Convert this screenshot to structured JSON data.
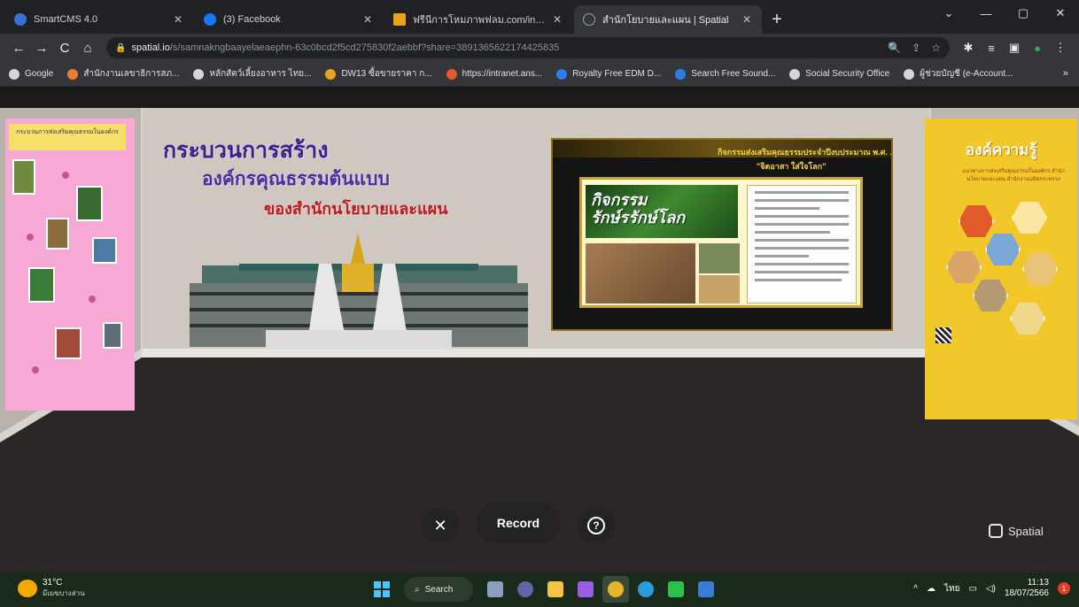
{
  "browser": {
    "tabs": [
      {
        "title": "SmartCMS 4.0",
        "favicon_color": "#3a6fd8",
        "close": "✕"
      },
      {
        "title": "(3) Facebook",
        "favicon_color": "#1877f2",
        "close": "✕"
      },
      {
        "title": "ฟรีนีการโหมภาพฟลม.com/index",
        "favicon_color": "#e8a317",
        "close": "✕"
      },
      {
        "title": "สำนักโยบายและแผน | Spatial",
        "favicon_color": "#5f6368",
        "close": "✕"
      }
    ],
    "new_tab": "+",
    "window_controls": [
      "⌄",
      "—",
      "▢",
      "✕"
    ],
    "nav": {
      "back": "←",
      "forward": "→",
      "reload": "C",
      "home": "⌂"
    },
    "url_host": "spatial.io",
    "url_path": "/s/samnakngbaayelaeaephn-63c0bcd2f5cd275830f2aebbf?share=3891365622174425835",
    "url_tools": [
      "🔍",
      "⇪",
      "☆"
    ],
    "toolbar_icons": [
      "✱",
      "≡",
      "▣",
      "●",
      "⋮"
    ],
    "bookmarks": [
      {
        "label": "Google",
        "color": "#d6d6d6"
      },
      {
        "label": "สำนักงานเลขาธิการสภ...",
        "color": "#f07b2a"
      },
      {
        "label": "หลักสัตว์เลี้ยงอาหาร ไทย...",
        "color": "#d6d6d6"
      },
      {
        "label": "DW13 ซื้อขายราคา ก...",
        "color": "#eaa51b"
      },
      {
        "label": "https://intranet.ans...",
        "color": "#e2592b"
      },
      {
        "label": "Royalty Free EDM D...",
        "color": "#2b7de9"
      },
      {
        "label": "Search Free Sound...",
        "color": "#2b7de9"
      },
      {
        "label": "Social Security Office",
        "color": "#d6d6d6"
      },
      {
        "label": "ผู้ช่วยบัญชี (e-Account...",
        "color": "#d6d6d6"
      }
    ],
    "bookmarks_more": "»"
  },
  "room": {
    "headline": {
      "line1": "กระบวนการสร้าง",
      "line2": "องค์กรคุณธรรมต้นแบบ",
      "line3": "ของสำนักนโยบายและแผน"
    },
    "center_board": {
      "title": "กิจกรรมส่งเสริมคุณธรรมประจำปีงบประมาณ พ.ศ. ...",
      "subtitle": "\"จิตอาสา ใส่ใจโลก\"",
      "green_title": "กิจกรรม\nรักษ์รรักษ์โลก"
    },
    "right_board": {
      "title": "องค์ความรู้",
      "subtitle": "แนวทางการส่งเสริมคุณธรรมในองค์กร สำนักนโยบายและแผน สำนักงานปลัดกระทรวง"
    },
    "left_board": {
      "header": "กระบวนการส่งเสริมคุณธรรมในองค์กร"
    },
    "controls": {
      "close": "✕",
      "record": "Record",
      "help": "?"
    },
    "brand": "Spatial"
  },
  "taskbar": {
    "weather_temp": "31°C",
    "weather_desc": "มีเมฆบางส่วน",
    "search": "Search",
    "apps": [
      {
        "name": "file-manager",
        "color": "#8aa0c0"
      },
      {
        "name": "teams",
        "color": "#6264a7"
      },
      {
        "name": "explorer",
        "color": "#f5c242"
      },
      {
        "name": "video",
        "color": "#9b5de5"
      },
      {
        "name": "chrome",
        "color": "#e7b52a"
      },
      {
        "name": "edge",
        "color": "#2b9be0"
      },
      {
        "name": "line",
        "color": "#2bc04b"
      },
      {
        "name": "paint",
        "color": "#3a7bd5"
      }
    ],
    "tray_lang": "ไทย",
    "tray_icons": [
      "^",
      "☁",
      "▭",
      "◁)"
    ],
    "time": "11:13",
    "date": "18/07/2566",
    "notif_count": "1"
  }
}
